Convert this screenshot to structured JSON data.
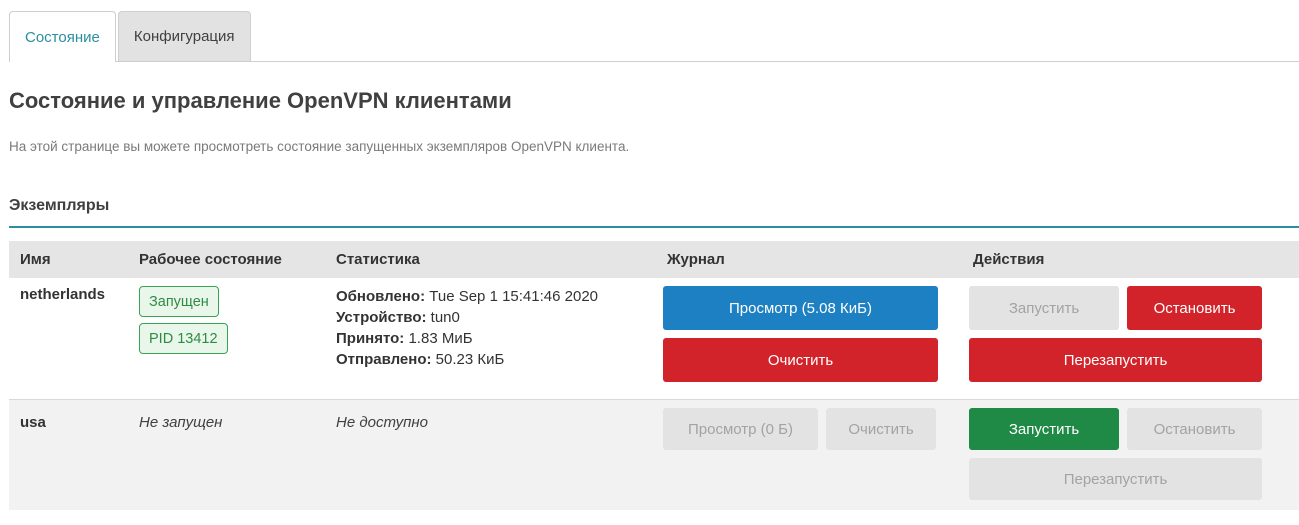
{
  "tabs": [
    {
      "label": "Состояние",
      "active": true
    },
    {
      "label": "Конфигурация",
      "active": false
    }
  ],
  "page": {
    "title": "Состояние и управление OpenVPN клиентами",
    "description": "На этой странице вы можете просмотреть состояние запущенных экземпляров OpenVPN клиента."
  },
  "section": {
    "title": "Экземпляры",
    "columns": [
      "Имя",
      "Рабочее состояние",
      "Статистика",
      "Журнал",
      "Действия"
    ],
    "rows": [
      {
        "name": "netherlands",
        "state_badge": "Запущен",
        "pid_badge": "PID 13412",
        "stats": {
          "updated_label": "Обновлено:",
          "updated_value": "Tue Sep 1 15:41:46 2020",
          "device_label": "Устройство:",
          "device_value": "tun0",
          "received_label": "Принято:",
          "received_value": "1.83 МиБ",
          "sent_label": "Отправлено:",
          "sent_value": "50.23 КиБ"
        },
        "log": {
          "view": "Просмотр (5.08 КиБ)",
          "clear": "Очистить"
        },
        "actions": {
          "start": "Запустить",
          "stop": "Остановить",
          "restart": "Перезапустить"
        }
      },
      {
        "name": "usa",
        "state_text": "Не запущен",
        "stats_text": "Не доступно",
        "log": {
          "view": "Просмотр (0 Б)",
          "clear": "Очистить"
        },
        "actions": {
          "start": "Запустить",
          "stop": "Остановить",
          "restart": "Перезапустить"
        }
      }
    ]
  },
  "colors": {
    "accent": "#2a8fa0",
    "blue": "#1d80c2",
    "red": "#d2232a",
    "green": "#1f8a45",
    "disabled": "#e3e3e3"
  }
}
